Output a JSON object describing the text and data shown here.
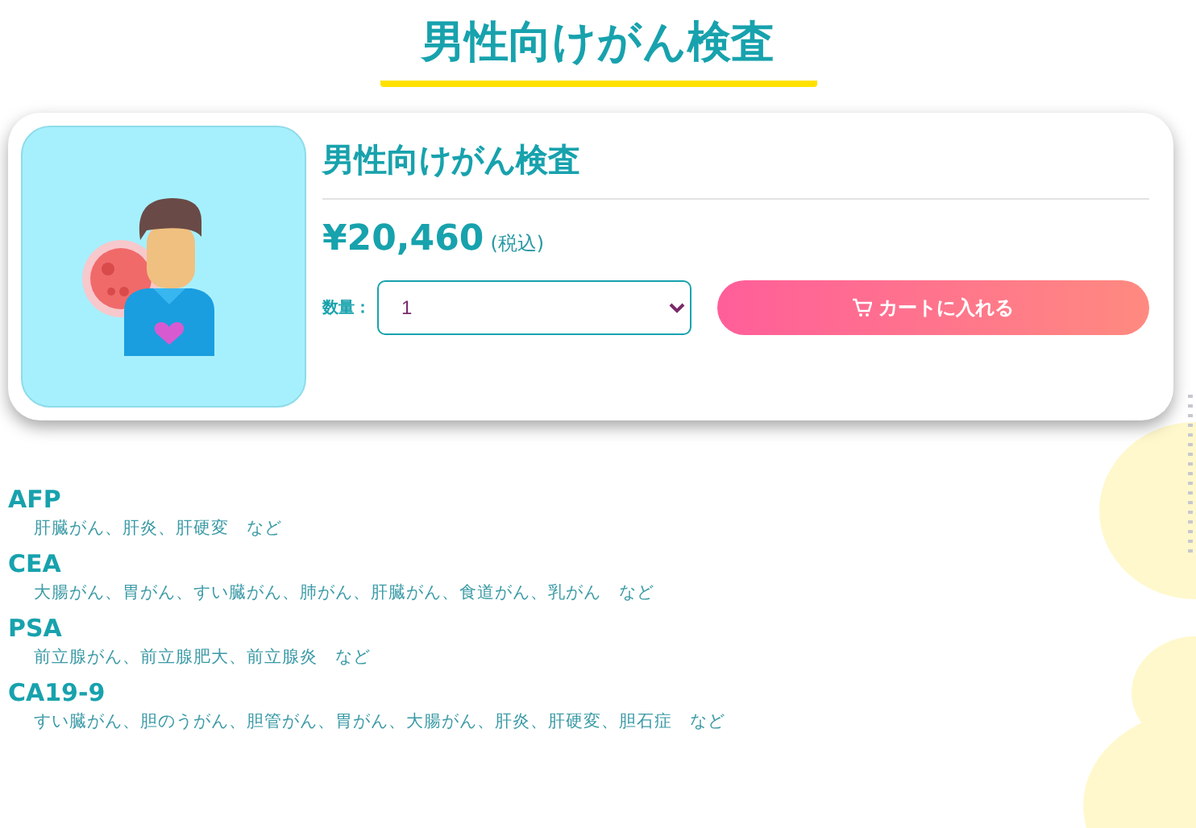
{
  "page_title": "男性向けがん検査",
  "product": {
    "name": "男性向けがん検査",
    "price": "¥20,460",
    "tax_note": "(税込)",
    "quantity_label": "数量：",
    "quantity": "1",
    "cart_button": "カートに入れる"
  },
  "markers": [
    {
      "name": "AFP",
      "description": "肝臓がん、肝炎、肝硬変　など"
    },
    {
      "name": "CEA",
      "description": "大腸がん、胃がん、すい臓がん、肺がん、肝臓がん、食道がん、乳がん　など"
    },
    {
      "name": "PSA",
      "description": "前立腺がん、前立腺肥大、前立腺炎　など"
    },
    {
      "name": "CA19-9",
      "description": "すい臓がん、胆のうがん、胆管がん、胃がん、大腸がん、肝炎、肝硬変、胆石症　など"
    }
  ]
}
